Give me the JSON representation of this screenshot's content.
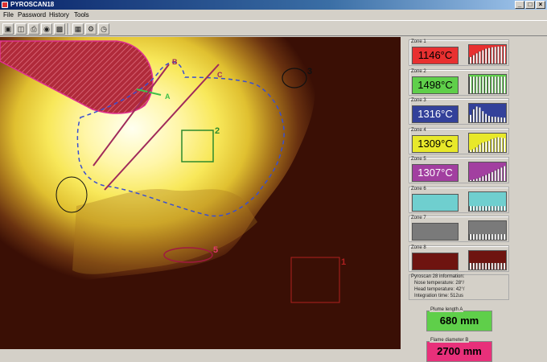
{
  "window": {
    "title": "PYROSCAN18",
    "controls": {
      "minimize": "_",
      "maximize": "□",
      "close": "×"
    }
  },
  "menu": [
    "File",
    "Password",
    "History",
    "Tools"
  ],
  "toolbar": [
    "save-icon",
    "open-folder-icon",
    "print-icon",
    "camera-icon",
    "chart-icon",
    "grid-icon",
    "settings-icon",
    "clock-icon"
  ],
  "zones": [
    {
      "label": "Zone 1",
      "temp": "1146°C",
      "color": "#e83030",
      "fill": [
        0.35,
        0.45,
        0.55,
        0.65,
        0.72,
        0.8,
        0.84,
        0.88,
        0.9,
        0.92,
        0.93,
        0.93
      ]
    },
    {
      "label": "Zone 2",
      "temp": "1498°C",
      "color": "#5fcf4a",
      "fill": [
        0.9,
        0.9,
        0.9,
        0.9,
        0.9,
        0.9,
        0.9,
        0.9,
        0.9,
        0.9,
        0.9,
        0.9
      ]
    },
    {
      "label": "Zone 3",
      "temp": "1316°C",
      "color": "#33419a",
      "fill": [
        0.4,
        0.7,
        0.85,
        0.8,
        0.6,
        0.45,
        0.35,
        0.3,
        0.3,
        0.28,
        0.26,
        0.25
      ]
    },
    {
      "label": "Zone 4",
      "temp": "1309°C",
      "color": "#e8e82a",
      "fill": [
        0.1,
        0.15,
        0.25,
        0.4,
        0.5,
        0.55,
        0.6,
        0.7,
        0.75,
        0.8,
        0.78,
        0.75
      ]
    },
    {
      "label": "Zone 5",
      "temp": "1307°C",
      "color": "#a23fa0",
      "fill": [
        0.05,
        0.08,
        0.12,
        0.18,
        0.25,
        0.32,
        0.4,
        0.48,
        0.56,
        0.64,
        0.72,
        0.8
      ]
    },
    {
      "label": "Zone 6",
      "temp": "",
      "color": "#6fcfcf",
      "fill": [
        0.25,
        0.25,
        0.25,
        0.25,
        0.25,
        0.25,
        0.25,
        0.25,
        0.25,
        0.25,
        0.25,
        0.25
      ]
    },
    {
      "label": "Zone 7",
      "temp": "",
      "color": "#7a7a7a",
      "fill": [
        0.3,
        0.3,
        0.3,
        0.3,
        0.3,
        0.3,
        0.3,
        0.3,
        0.3,
        0.3,
        0.3,
        0.3
      ]
    },
    {
      "label": "Zone 8",
      "temp": "",
      "color": "#6e1410",
      "fill": [
        0.35,
        0.35,
        0.35,
        0.35,
        0.35,
        0.35,
        0.35,
        0.35,
        0.35,
        0.35,
        0.35,
        0.35
      ]
    }
  ],
  "info": {
    "title": "Pyroscan 28 information:",
    "nose": "Nose temperature: 28°/",
    "head": "Head temperature: 42°/",
    "integration": "Integration time: 512us"
  },
  "plume": {
    "label": "Plume length A",
    "value": "680 mm",
    "color": "#5fcf4a"
  },
  "flame": {
    "label": "Flame diameter B",
    "value": "2700 mm",
    "color": "#e8307a"
  },
  "overlay": {
    "line_labels": [
      "A",
      "B",
      "C"
    ],
    "zone_markers": [
      "1",
      "2",
      "3",
      "5"
    ],
    "colors": {
      "line_a": "#3fbf4a",
      "line_b": "#a02a5a",
      "line_c": "#a02a5a",
      "contour": "#3a4fd0",
      "zone1": "#b02020",
      "zone2": "#2d8a2d",
      "zone3": "#111111",
      "zone5": "#a01a40"
    }
  }
}
